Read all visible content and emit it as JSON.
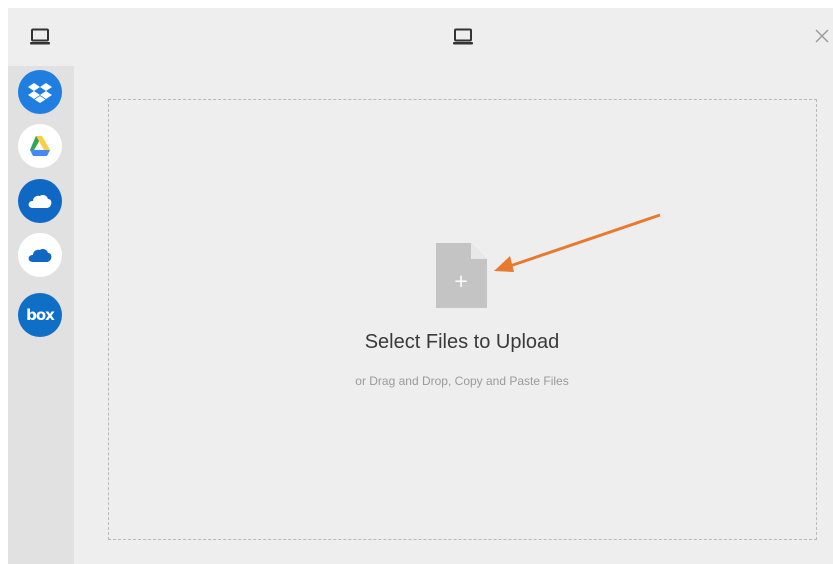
{
  "dialog": {
    "close_symbol": "✕"
  },
  "sources": [
    {
      "name": "dropbox",
      "icon": "dropbox-icon",
      "color": "#1f7ee0"
    },
    {
      "name": "google-drive",
      "icon": "google-drive-icon",
      "color": "#ffffff"
    },
    {
      "name": "onedrive",
      "icon": "onedrive-icon",
      "color": "#0e68c4"
    },
    {
      "name": "onedrive-business",
      "icon": "onedrive-business-icon",
      "color": "#ffffff"
    },
    {
      "name": "box",
      "icon": "box-icon",
      "label": "box",
      "color": "#0f6fc6"
    }
  ],
  "dropzone": {
    "title": "Select Files to Upload",
    "subtitle": "or Drag and Drop, Copy and Paste Files",
    "add_symbol": "+"
  },
  "annotation": {
    "arrow_color": "#e87a30"
  }
}
